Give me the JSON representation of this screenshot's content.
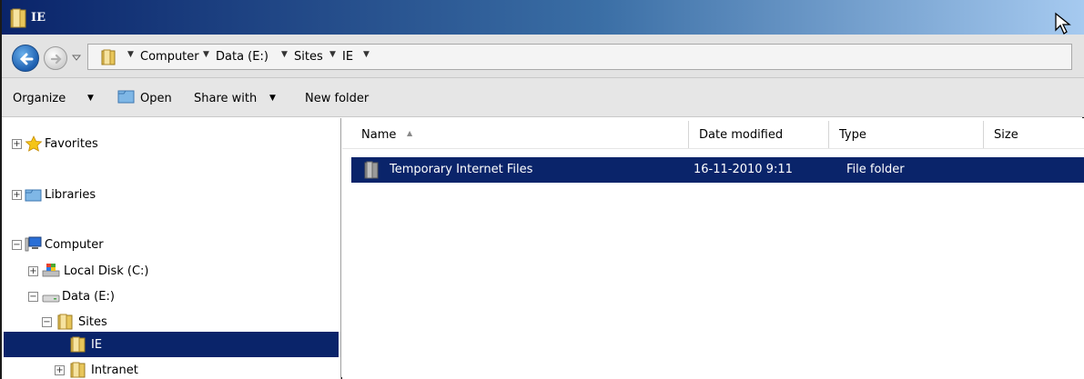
{
  "window": {
    "title": "IE"
  },
  "address": {
    "crumbs": [
      "Computer",
      "Data (E:)",
      "Sites",
      "IE"
    ]
  },
  "toolbar": {
    "organize": "Organize",
    "open": "Open",
    "share_with": "Share with",
    "new_folder": "New folder"
  },
  "nav": {
    "favorites": "Favorites",
    "libraries": "Libraries",
    "computer": "Computer",
    "local_disk": "Local Disk (C:)",
    "data": "Data (E:)",
    "sites": "Sites",
    "ie": "IE",
    "intranet": "Intranet"
  },
  "columns": {
    "name": "Name",
    "date_modified": "Date modified",
    "type": "Type",
    "size": "Size"
  },
  "files": [
    {
      "name": "Temporary Internet Files",
      "date_modified": "16-11-2010 9:11",
      "type": "File folder",
      "size": ""
    }
  ],
  "colors": {
    "selection": "#0a246a",
    "title_start": "#0a246a",
    "title_end": "#a6caf0"
  }
}
